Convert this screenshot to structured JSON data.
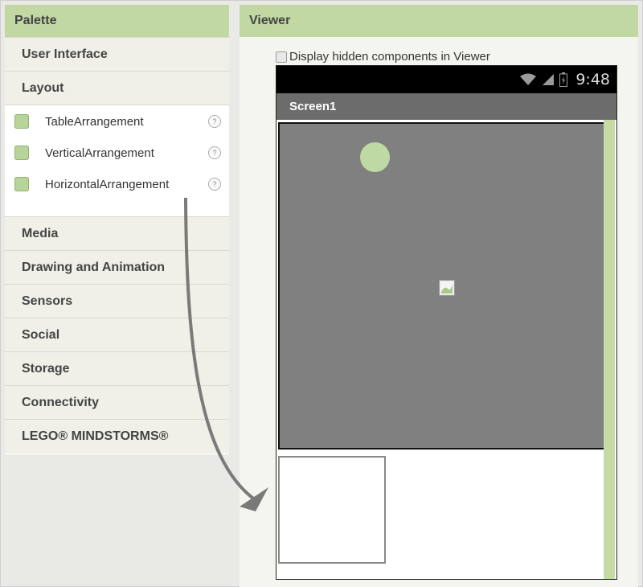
{
  "palette": {
    "title": "Palette",
    "categories_top": [
      "User Interface",
      "Layout"
    ],
    "layout_items": [
      {
        "label": "TableArrangement",
        "icon": "table-arrangement-icon"
      },
      {
        "label": "VerticalArrangement",
        "icon": "vertical-arrangement-icon"
      },
      {
        "label": "HorizontalArrangement",
        "icon": "horizontal-arrangement-icon"
      }
    ],
    "help_glyph": "?",
    "categories_bottom": [
      "Media",
      "Drawing and Animation",
      "Sensors",
      "Social",
      "Storage",
      "Connectivity",
      "LEGO® MINDSTORMS®"
    ]
  },
  "viewer": {
    "title": "Viewer",
    "hidden_components_label": "Display hidden components in Viewer",
    "phone": {
      "time": "9:48",
      "screen_title": "Screen1"
    }
  },
  "colors": {
    "header": "#c1d8a3",
    "canvas": "#808080",
    "ball": "#bfd9a2",
    "titlebar": "#6c6c6c"
  }
}
